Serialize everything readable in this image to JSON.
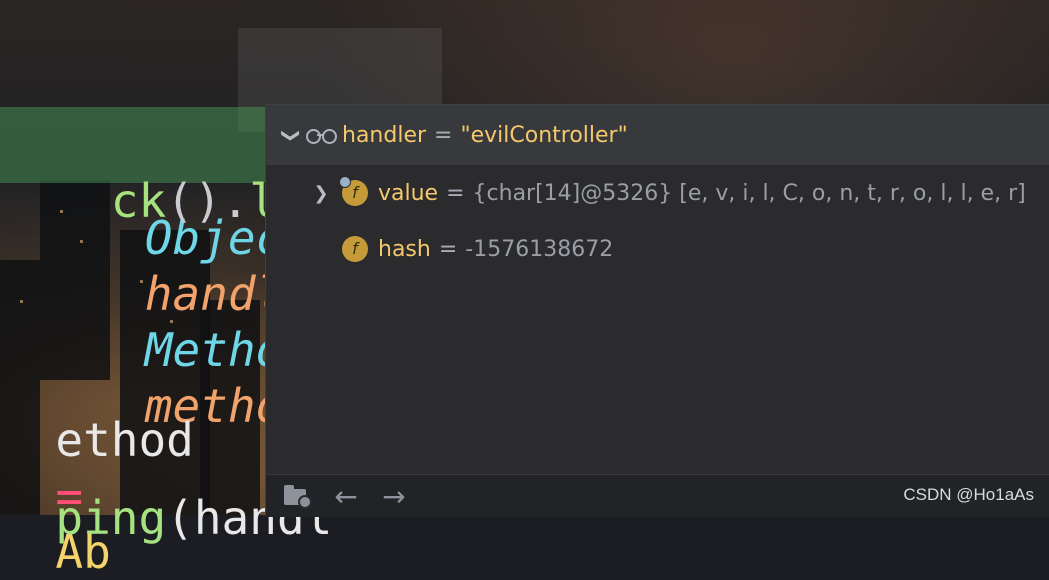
{
  "code": {
    "line1": {
      "type1": "Object",
      "param1": "handler",
      "comma": ",",
      "type2": "Method",
      "param2": "method",
      "tail": ") {",
      "cut": "h"
    },
    "line2": {
      "fragment_a": "ck",
      "fragment_b": "().",
      "fragment_c": "lock",
      "fragment_d": "("
    },
    "line3": {
      "fragment_a": "ethod",
      "op": "=",
      "fragment_b": "Ab"
    },
    "line4": {
      "fragment_a": "ping",
      "fragment_b": "(handl"
    }
  },
  "debugger": {
    "root": {
      "name": "handler",
      "eq": "=",
      "value": "\"evilController\""
    },
    "fields": [
      {
        "name": "value",
        "eq": "=",
        "value": "{char[14]@5326} [e, v, i, l, C, o, n, t, r, o, l, l, e, r]",
        "badge": "f",
        "expandable": true
      },
      {
        "name": "hash",
        "eq": "=",
        "value": "-1576138672",
        "badge": "f",
        "expandable": false
      }
    ],
    "watermark": "CSDN @Ho1aAs"
  },
  "icons": {
    "expand": "chevron-right-icon",
    "collapse": "chevron-down-icon",
    "watch": "glasses-icon",
    "field": "field-icon",
    "back": "arrow-left-icon",
    "forward": "arrow-right-icon",
    "folder": "folder-icon"
  },
  "colors": {
    "field_badge": "#c59b3a",
    "var_name": "#f5c96b",
    "popup_bg": "#2b2b2d"
  }
}
